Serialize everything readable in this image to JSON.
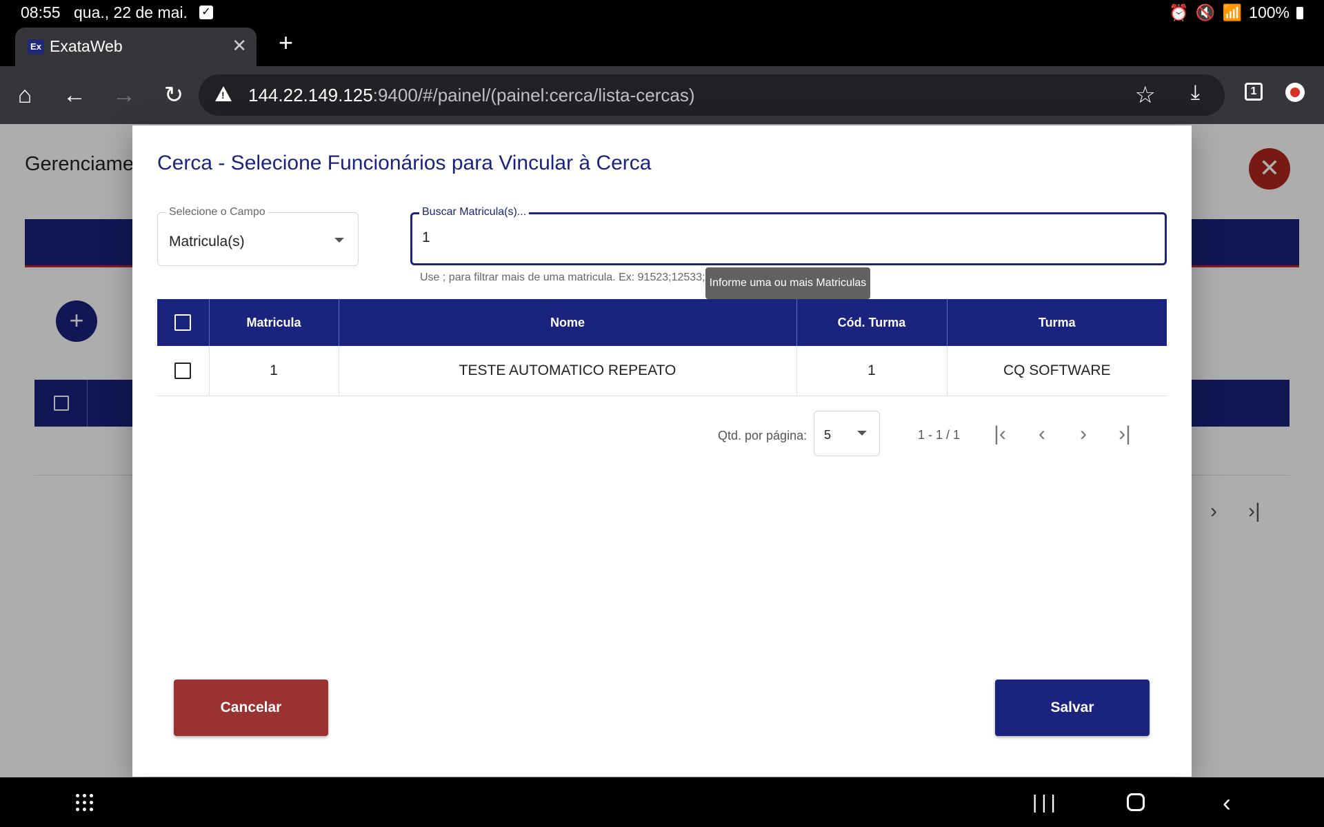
{
  "status_bar": {
    "time": "08:55",
    "date": "qua., 22 de mai.",
    "battery": "100%"
  },
  "browser": {
    "tab_title": "ExataWeb",
    "tab_favicon": "Ex",
    "url_host": "144.22.149.125",
    "url_rest": ":9400/#/painel/(painel:cerca/lista-cercas)",
    "tab_count": "1"
  },
  "page": {
    "heading": "Gerenciame"
  },
  "dialog": {
    "title": "Cerca - Selecione Funcionários para Vincular à Cerca",
    "select_label": "Selecione o Campo",
    "select_value": "Matricula(s)",
    "search_label": "Buscar Matricula(s)...",
    "search_value": "1",
    "hint": "Use ; para filtrar mais de uma matricula. Ex: 91523;12533;...",
    "tooltip": "Informe uma ou mais Matriculas",
    "table": {
      "headers": [
        "Matricula",
        "Nome",
        "Cód. Turma",
        "Turma"
      ],
      "rows": [
        [
          "1",
          "TESTE AUTOMATICO REPEATO",
          "1",
          "CQ SOFTWARE"
        ]
      ]
    },
    "paginator": {
      "label": "Qtd. por página:",
      "page_size": "5",
      "range": "1 - 1 / 1"
    },
    "cancel_label": "Cancelar",
    "save_label": "Salvar"
  },
  "colors": {
    "primary": "#1a237e",
    "danger": "#9a3232"
  }
}
